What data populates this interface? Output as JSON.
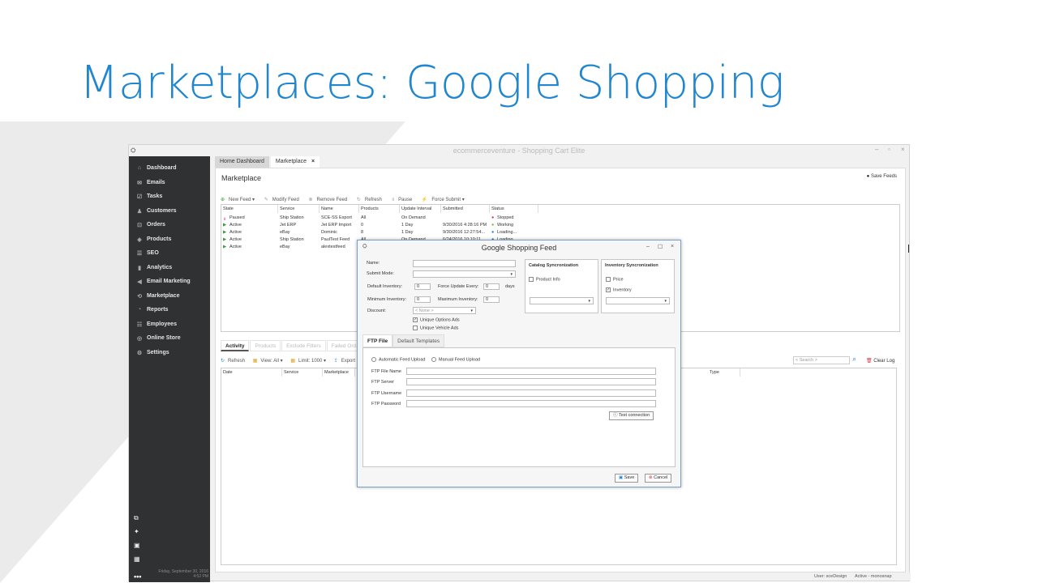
{
  "slide": {
    "title": "Marketplaces: Google Shopping"
  },
  "app": {
    "title": "ecommerceventure - Shopping Cart Elite",
    "logo_icon": "app-logo-icon",
    "window_controls": [
      "–",
      "▫",
      "×"
    ]
  },
  "sidebar": {
    "items": [
      {
        "label": "Dashboard",
        "icon": "⌂"
      },
      {
        "label": "Emails",
        "icon": "✉"
      },
      {
        "label": "Tasks",
        "icon": "☑"
      },
      {
        "label": "Customers",
        "icon": "♟"
      },
      {
        "label": "Orders",
        "icon": "⊡"
      },
      {
        "label": "Products",
        "icon": "◈"
      },
      {
        "label": "SEO",
        "icon": "☰"
      },
      {
        "label": "Analytics",
        "icon": "▮"
      },
      {
        "label": "Email Marketing",
        "icon": "◀"
      },
      {
        "label": "Marketplace",
        "icon": "⟲"
      },
      {
        "label": "Reports",
        "icon": "◔"
      },
      {
        "label": "Employees",
        "icon": "☷"
      },
      {
        "label": "Online Store",
        "icon": "◎"
      },
      {
        "label": "Settings",
        "icon": "⚙"
      }
    ],
    "bottom_icons": [
      "⧉",
      "✦",
      "▣",
      "▦"
    ],
    "date": "Friday, September 30, 2016",
    "time": "4:52 PM",
    "more": "•••"
  },
  "tabs": [
    {
      "label": "Home Dashboard"
    },
    {
      "label": "Marketplace",
      "close": "×"
    }
  ],
  "marketplace": {
    "title": "Marketplace",
    "save_feeds": "Save Feeds",
    "toolbar": [
      "New Feed ▾",
      "Modify Feed",
      "Remove Feed",
      "Refresh",
      "Pause",
      "Force Submit ▾"
    ],
    "columns": [
      "State",
      "Service",
      "Name",
      "Products",
      "Update Interval",
      "Submitted",
      "Status"
    ],
    "rows": [
      [
        "Paused",
        "Ship Station",
        "SCE-SS Export",
        "All",
        "On Demand",
        "",
        "Stopped"
      ],
      [
        "Active",
        "Jet ERP",
        "Jet ERP Import",
        "0",
        "1 Day",
        "9/30/2016 4:28:16 PM",
        "Working"
      ],
      [
        "Active",
        "eBay",
        "Dominic",
        "8",
        "1 Day",
        "9/30/2016 12:27:54...",
        "Loading..."
      ],
      [
        "Active",
        "Ship Station",
        "PaulTest Feed",
        "All",
        "On Demand",
        "6/24/2016 10:10:11...",
        "Loading..."
      ],
      [
        "Active",
        "eBay",
        "alextestfeed",
        "",
        "",
        "",
        ""
      ]
    ],
    "status_colors": {
      "Stopped": "#d9363e",
      "Working": "#7cb342",
      "Loading...": "#1f86cf"
    }
  },
  "activity": {
    "tabs": [
      "Activity",
      "Products",
      "Exclude Filters",
      "Failed Ord..."
    ],
    "toolbar": [
      "Refresh",
      "View: All ▾",
      "Limit: 1000 ▾",
      "Export"
    ],
    "columns": [
      "Date",
      "Service",
      "Marketplace",
      "Type"
    ],
    "search_placeholder": "< Search >",
    "clear_log": "Clear Log"
  },
  "status_bar": {
    "user": "User: sceDesign",
    "active": "Active - monosnap"
  },
  "dialog": {
    "title": "Google Shopping Feed",
    "controls": [
      "–",
      "☐",
      "×"
    ],
    "name_label": "Name:",
    "submit_mode_label": "Submit Mode:",
    "default_inventory_label": "Default Inventory:",
    "default_inventory_value": "0",
    "force_update_label": "Force Update Every:",
    "force_update_value": "0",
    "days_label": "days",
    "min_inventory_label": "Minimum Inventory:",
    "min_inventory_value": "0",
    "max_inventory_label": "Maximum Inventory:",
    "max_inventory_value": "0",
    "discount_label": "Discount:",
    "discount_value": "< None >",
    "unique_options_label": "Unique Options Ads",
    "unique_vehicle_label": "Unique Vehicle Ads",
    "catalog_title": "Catalog Syncronization",
    "product_info_label": "Product Info",
    "inventory_title": "Inventory Syncronization",
    "price_label": "Price",
    "inventory_label": "Inventory",
    "tabs": [
      "FTP File",
      "Default Templates"
    ],
    "auto_upload_label": "Automatic Feed Upload",
    "manual_upload_label": "Manual Feed Upload",
    "ftp_file_name_label": "FTP File Name",
    "ftp_server_label": "FTP Server",
    "ftp_username_label": "FTP Username",
    "ftp_password_label": "FTP Password",
    "test_connection": "Test connection",
    "save": "Save",
    "cancel": "Cancel"
  }
}
